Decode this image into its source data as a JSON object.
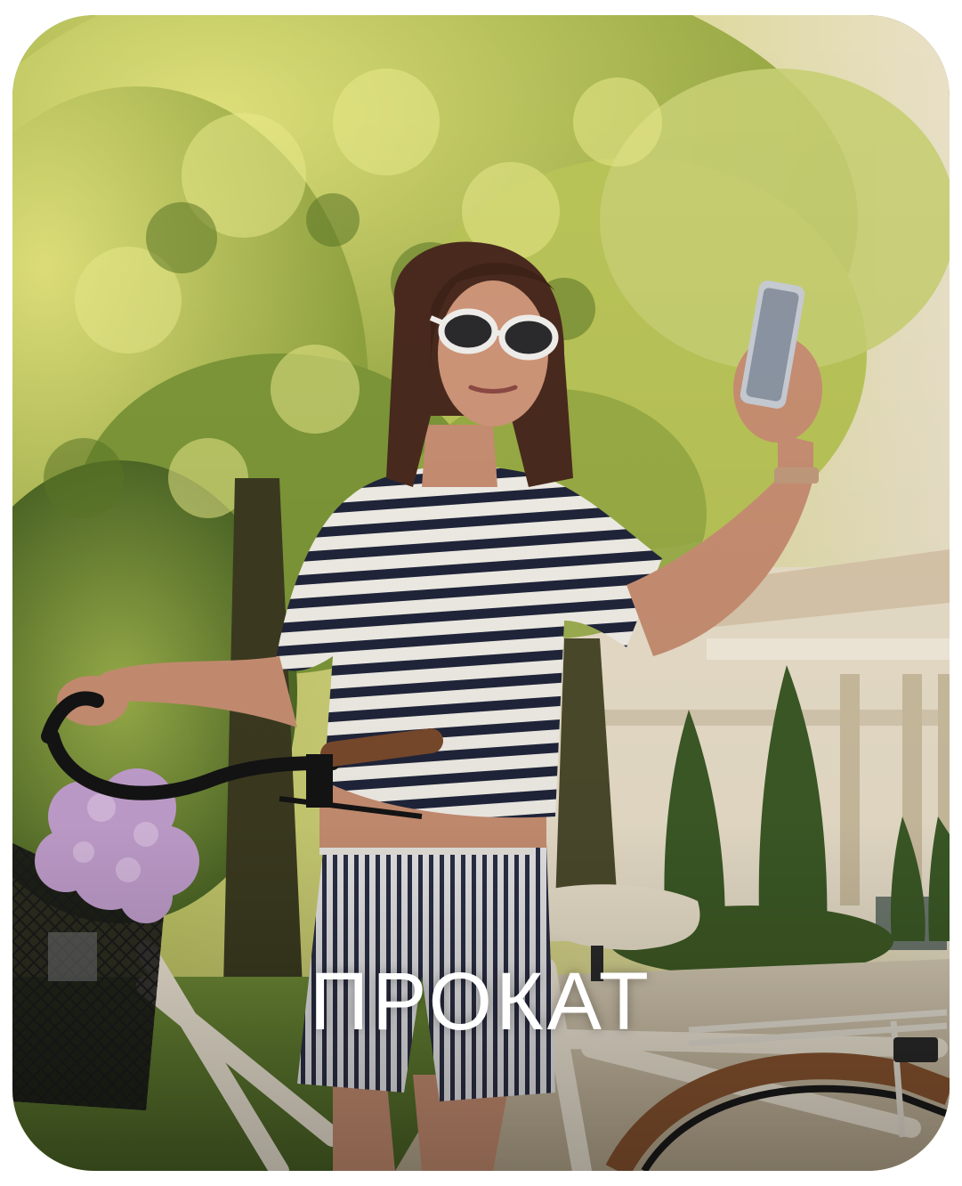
{
  "tile": {
    "label": "ПРОКАТ",
    "photo_subject": "woman-with-bicycle-taking-selfie-photo"
  },
  "colors": {
    "label_text": "#ffffff",
    "foliage_light": "#c9cf6a",
    "foliage_dark": "#4f6a24",
    "sky": "#e7dfc6",
    "building": "#ece3cf"
  }
}
